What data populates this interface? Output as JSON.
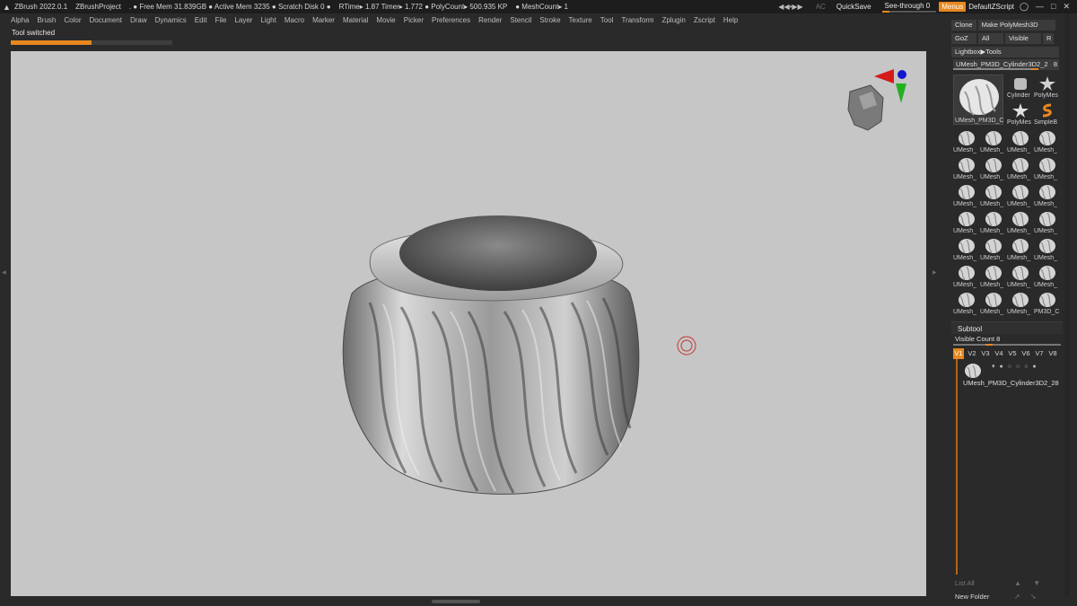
{
  "titlebar": {
    "items": [
      "ZBrush 2022.0.1",
      "ZBrushProject",
      ". ● Free Mem 31.839GB ● Active Mem 3235 ● Scratch Disk 0 ●",
      "RTime▸ 1.87 Timer▸ 1.772 ● PolyCount▸ 500.935 KP",
      "● MeshCount▸ 1"
    ],
    "ac": "AC",
    "quicksave": "QuickSave",
    "seethrough": "See-through   0",
    "seethrough_level": 0,
    "menus": "Menus",
    "script": "DefaultZScript"
  },
  "menubar": [
    "Alpha",
    "Brush",
    "Color",
    "Document",
    "Draw",
    "Dynamics",
    "Edit",
    "File",
    "Layer",
    "Light",
    "Macro",
    "Marker",
    "Material",
    "Movie",
    "Picker",
    "Preferences",
    "Render",
    "Stencil",
    "Stroke",
    "Texture",
    "Tool",
    "Transform",
    "Zplugin",
    "Zscript",
    "Help"
  ],
  "notice": "Tool switched",
  "progress_fraction": 0.5,
  "rpanel": {
    "row1": [
      "Clone",
      "Make PolyMesh3D"
    ],
    "row2": [
      "GoZ",
      "All",
      "Visible",
      "R"
    ],
    "lightbox": "Lightbox▶Tools",
    "tool_name": "UMesh_PM3D_Cylinder3D2_2",
    "tool_count": "8",
    "large_thumb": "UMesh_PM3D_C",
    "small_thumbs": [
      "Cylinder",
      "PolyMes",
      "PolyMes",
      "SimpleB"
    ],
    "grid_label": "UMesh_",
    "grid_last": "PM3D_C"
  },
  "subtool": {
    "title": "Subtool",
    "visible_count": "Visible Count 8",
    "visible_fraction": 0.3,
    "versions": [
      "V1",
      "V2",
      "V3",
      "V4",
      "V5",
      "V6",
      "V7",
      "V8"
    ],
    "item": "UMesh_PM3D_Cylinder3D2_28",
    "list_all": "List All",
    "new_folder": "New Folder"
  },
  "colors": {
    "accent": "#e8871f",
    "canvas": "#c6c6c6",
    "panel": "#2a2a2a"
  }
}
